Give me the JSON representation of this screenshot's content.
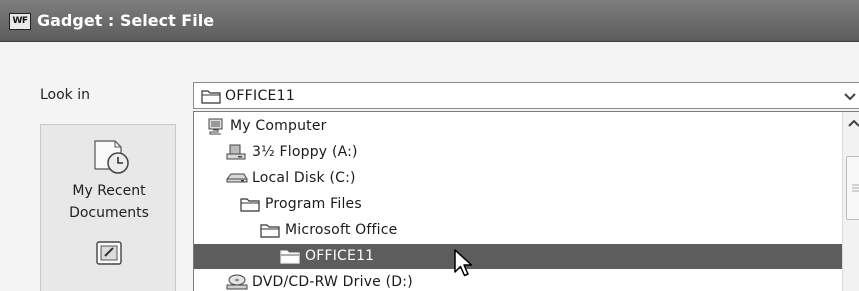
{
  "window": {
    "app_icon_text": "WF",
    "title": "Gadget : Select File"
  },
  "look_in": {
    "label": "Look in",
    "selected": "OFFICE11"
  },
  "places_bar": {
    "items": [
      {
        "label_line1": "My Recent",
        "label_line2": "Documents",
        "icon": "recent-documents-icon"
      },
      {
        "label_line1": "",
        "label_line2": "",
        "icon": "desktop-icon"
      }
    ]
  },
  "dropdown": {
    "items": [
      {
        "label": "My Computer",
        "icon": "my-computer-icon",
        "level": 0,
        "selected": false
      },
      {
        "label": "3½ Floppy (A:)",
        "icon": "floppy-drive-icon",
        "level": 1,
        "selected": false
      },
      {
        "label": "Local Disk (C:)",
        "icon": "hard-disk-icon",
        "level": 1,
        "selected": false
      },
      {
        "label": "Program Files",
        "icon": "folder-icon",
        "level": 2,
        "selected": false
      },
      {
        "label": "Microsoft Office",
        "icon": "folder-icon",
        "level": 3,
        "selected": false
      },
      {
        "label": "OFFICE11",
        "icon": "folder-open-icon",
        "level": 4,
        "selected": true
      },
      {
        "label": "DVD/CD-RW Drive (D:)",
        "icon": "cd-drive-icon",
        "level": 1,
        "selected": false
      }
    ]
  },
  "colors": {
    "titlebar": "#6a6a6a",
    "selection": "#5d5d5d",
    "background": "#f4f4f4"
  }
}
